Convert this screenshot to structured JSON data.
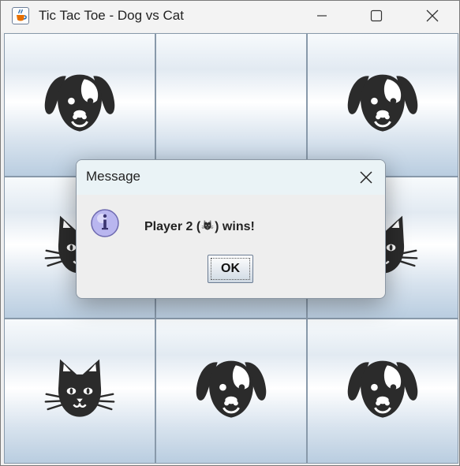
{
  "window": {
    "title": "Tic Tac Toe - Dog vs Cat",
    "app_icon": "java-cup-icon",
    "controls": [
      "minimize-icon",
      "maximize-icon",
      "close-icon"
    ]
  },
  "board": {
    "cells": [
      "dog",
      "",
      "dog",
      "cat",
      "",
      "cat",
      "cat",
      "dog",
      "dog"
    ]
  },
  "dialog": {
    "title": "Message",
    "icon": "info-icon",
    "message_prefix": "Player 2 (",
    "message_icon": "cat-icon",
    "message_suffix": ") wins!",
    "ok_label": "OK"
  },
  "colors": {
    "piece": "#2b2b2b",
    "cell_highlight": "#ffffff",
    "cell_shadow": "#b9cde0",
    "info_icon": "#b9b6ef"
  }
}
